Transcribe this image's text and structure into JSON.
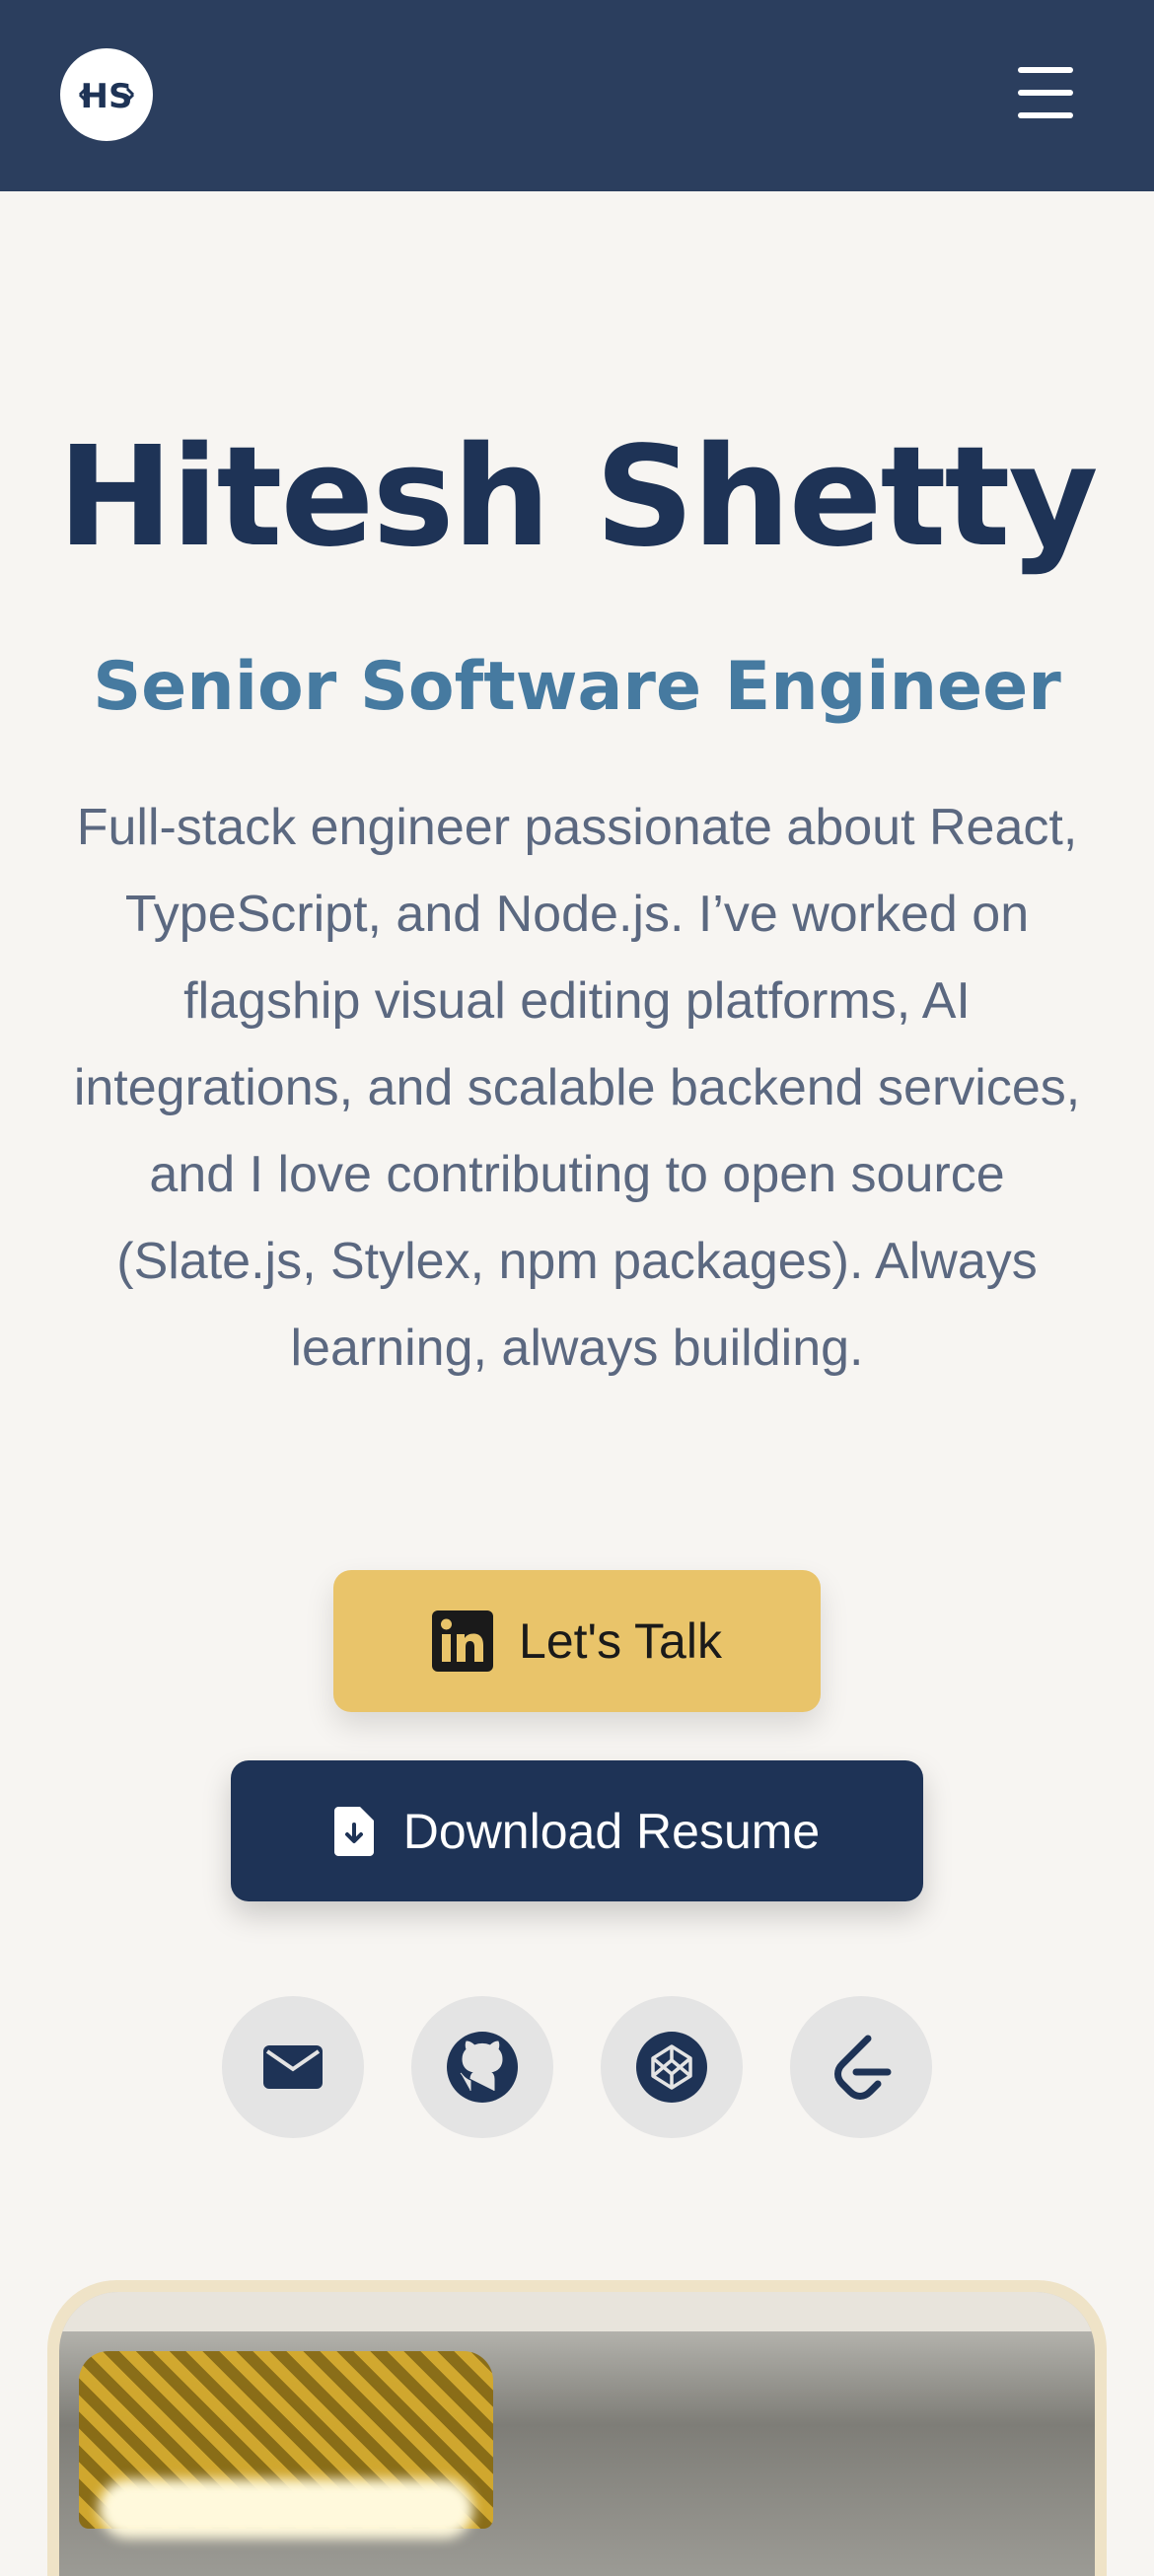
{
  "header": {
    "logo_text": "HS",
    "menu_icon": "hamburger-menu-icon"
  },
  "hero": {
    "name": "Hitesh Shetty",
    "role": "Senior Software Engineer",
    "bio": "Full-stack engineer passionate about React, TypeScript, and Node.js. I’ve worked on flagship visual editing platforms, AI integrations, and scalable backend services, and I love contributing to open source (Slate.js, Stylex, npm packages). Always learning, always building."
  },
  "buttons": {
    "talk_label": "Let's Talk",
    "talk_icon": "linkedin-icon",
    "resume_label": "Download Resume",
    "resume_icon": "file-download-icon"
  },
  "socials": [
    {
      "icon": "mail-icon"
    },
    {
      "icon": "github-icon"
    },
    {
      "icon": "codepen-icon"
    },
    {
      "icon": "leetcode-icon"
    }
  ],
  "colors": {
    "header_bg": "#2b3e5e",
    "page_bg": "#f7f5f2",
    "name": "#1e3356",
    "role": "#467aa0",
    "bio": "#5b6880",
    "talk_button": "#e9c46a",
    "resume_button": "#1e3356",
    "social_bg": "#e4e4e4"
  }
}
